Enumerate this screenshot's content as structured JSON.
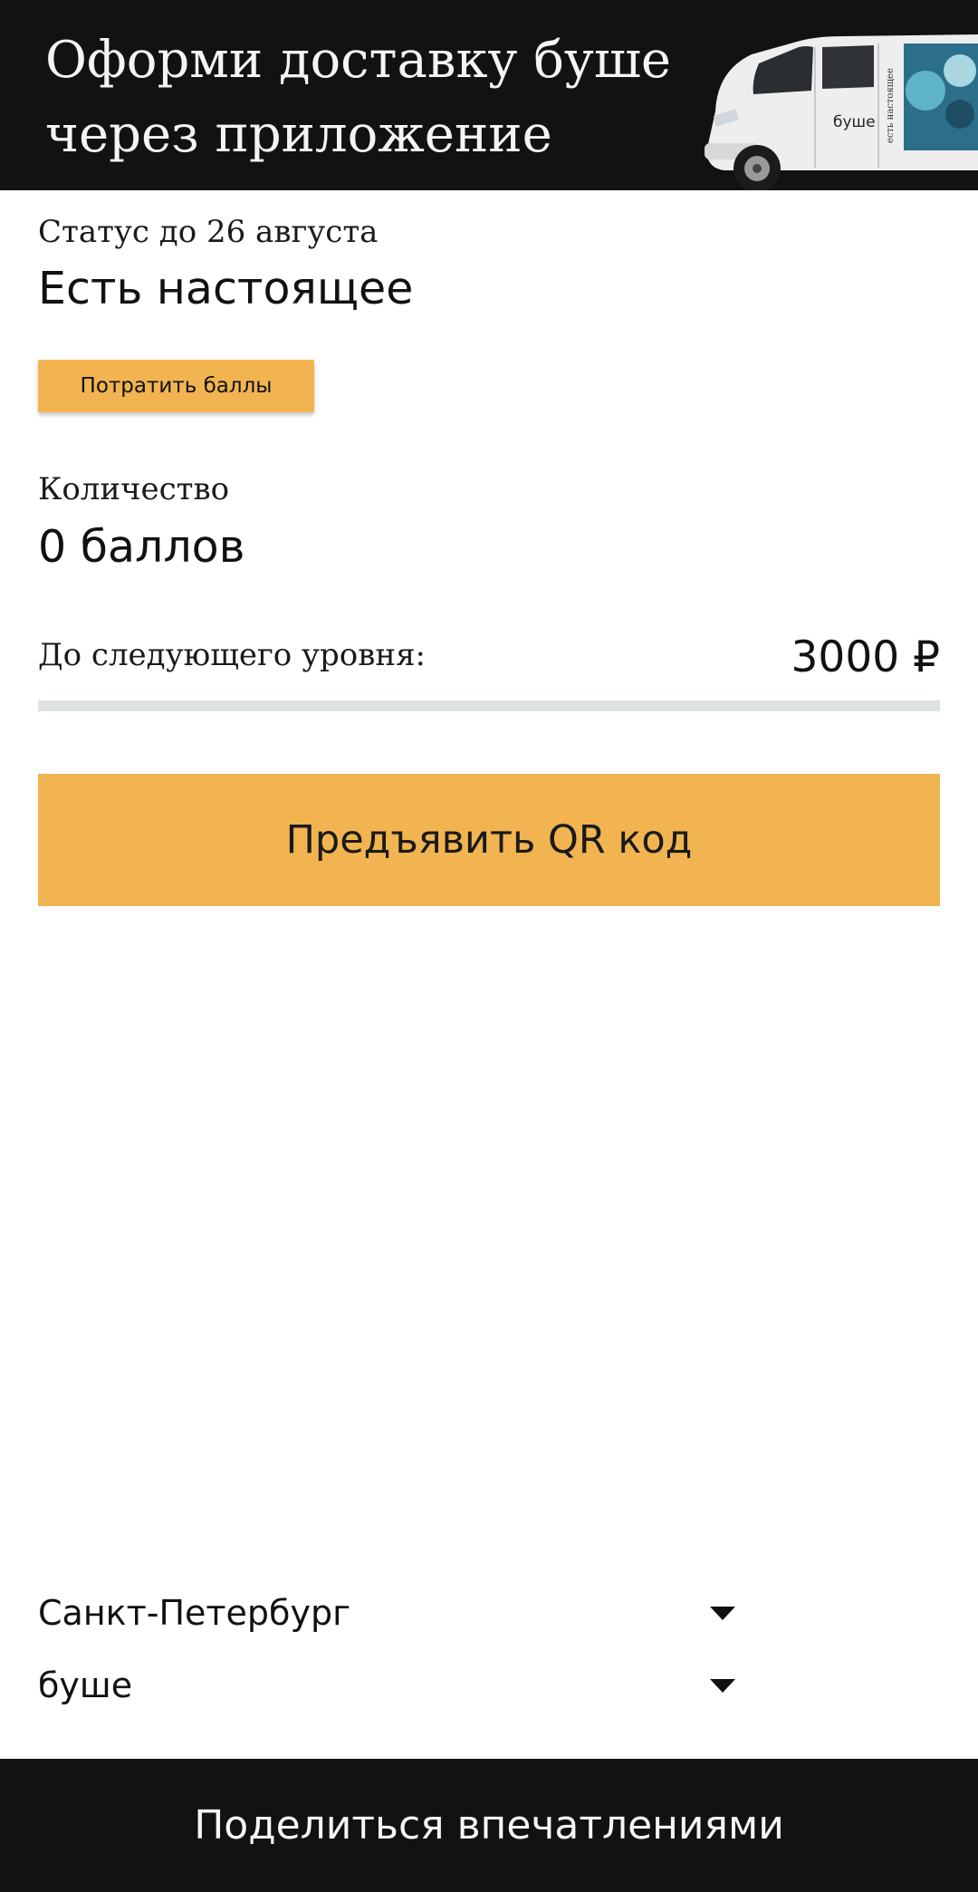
{
  "banner": {
    "title": "Оформи доставку буше через приложение",
    "van_logo": "буше",
    "van_side_text": "есть настоящее"
  },
  "status": {
    "caption": "Статус до 26 августа",
    "value": "Есть настоящее"
  },
  "spend_button": {
    "label": "Потратить баллы"
  },
  "points": {
    "caption": "Количество",
    "value": "0 баллов"
  },
  "next_level": {
    "caption": "До следующего уровня:",
    "value": "3000 ₽",
    "progress": 0
  },
  "qr_button": {
    "label": "Предъявить QR код"
  },
  "selectors": {
    "city": {
      "value": "Санкт-Петербург",
      "icon": "caret-down-icon"
    },
    "brand": {
      "value": "буше",
      "icon": "caret-down-icon"
    }
  },
  "footer": {
    "label": "Поделиться впечатлениями"
  },
  "colors": {
    "accent": "#f1b450",
    "dark": "#121212",
    "track": "#dfe3df"
  }
}
